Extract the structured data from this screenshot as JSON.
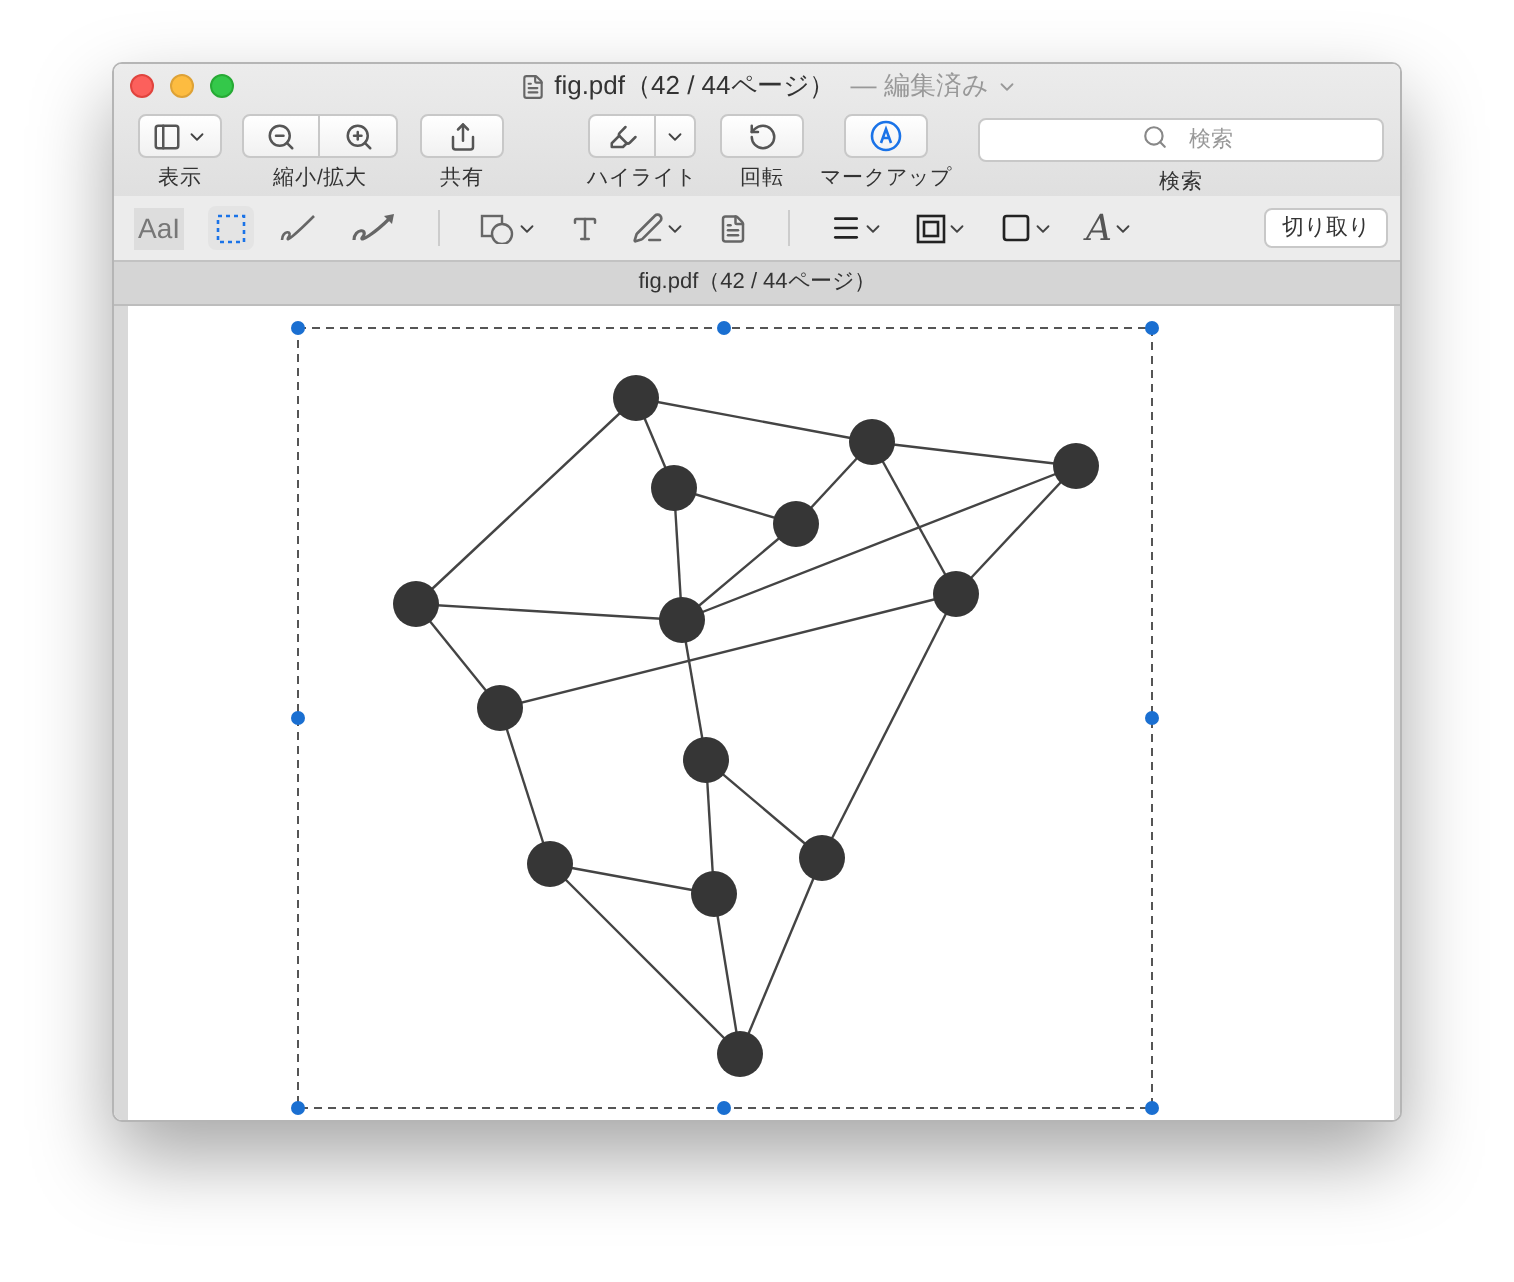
{
  "window": {
    "title": "fig.pdf",
    "page_info": "（42 / 44ページ）",
    "edited": "— 編集済み"
  },
  "toolbar": [
    {
      "kind": "sidebar",
      "label": "表示"
    },
    {
      "kind": "zoom",
      "label": "縮小/拡大"
    },
    {
      "kind": "share",
      "label": "共有"
    },
    {
      "kind": "highlight",
      "label": "ハイライト"
    },
    {
      "kind": "rotate",
      "label": "回転"
    },
    {
      "kind": "markup",
      "label": "マークアップ"
    }
  ],
  "search": {
    "placeholder": "検索",
    "label": "検索"
  },
  "markup_tools": [
    {
      "kind": "text-style",
      "text": "AaI",
      "selected": false
    },
    {
      "kind": "rect-select",
      "selected": true
    },
    {
      "kind": "sketch",
      "selected": false
    },
    {
      "kind": "draw",
      "selected": false
    },
    {
      "kind": "shapes",
      "selected": false
    },
    {
      "kind": "text",
      "selected": false
    },
    {
      "kind": "sign",
      "selected": false
    },
    {
      "kind": "note",
      "selected": false
    },
    {
      "kind": "line-style",
      "selected": false
    },
    {
      "kind": "border",
      "selected": false
    },
    {
      "kind": "fill",
      "selected": false
    },
    {
      "kind": "font",
      "text": "A",
      "selected": false
    }
  ],
  "crop_button": "切り取り",
  "tab_title": "fig.pdf（42 / 44ページ）"
}
